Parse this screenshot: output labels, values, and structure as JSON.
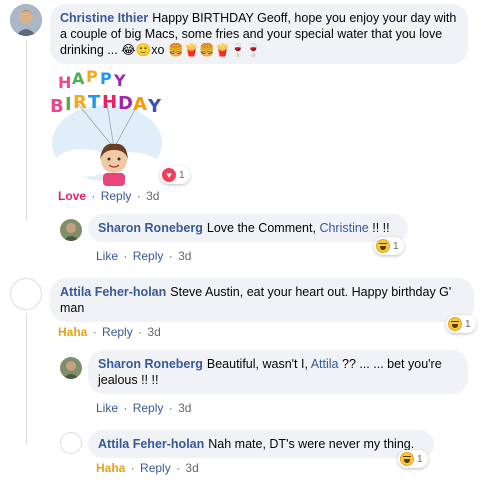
{
  "comments": [
    {
      "author": "Christine Ithier",
      "text": "Happy BIRTHDAY Geoff, hope you enjoy your day with a couple of big Macs, some fries and your special water that you love drinking ... 😂🙂xo 🍔🍟🍔🍟🍷🍷",
      "sticker_text": "HAPPY BIRTHDAY",
      "reaction_count": "1",
      "actions": {
        "reaction": "Love",
        "reply": "Reply",
        "time": "3d"
      }
    },
    {
      "author": "Sharon Roneberg",
      "text_before": "Love the Comment, ",
      "mention": "Christine",
      "text_after": " !! !!",
      "reaction_count": "1",
      "actions": {
        "like": "Like",
        "reply": "Reply",
        "time": "3d"
      }
    },
    {
      "author": "Attila Feher-holan",
      "text": "Steve Austin, eat your heart out. Happy birthday G' man",
      "reaction_count": "1",
      "actions": {
        "reaction": "Haha",
        "reply": "Reply",
        "time": "3d"
      }
    },
    {
      "author": "Sharon Roneberg",
      "text_before": "Beautiful, wasn't I, ",
      "mention": "Attila",
      "text_after": " ?? ... ... bet you're jealous !! !!",
      "actions": {
        "like": "Like",
        "reply": "Reply",
        "time": "3d"
      }
    },
    {
      "author": "Attila Feher-holan",
      "text": "Nah mate, DT's were never my thing.",
      "reaction_count": "1",
      "actions": {
        "reaction": "Haha",
        "reply": "Reply",
        "time": "3d"
      }
    }
  ],
  "separator": "·",
  "colors": {
    "link": "#385898",
    "love": "#e0245e",
    "haha": "#e3a21a",
    "bubble": "#f0f2f5"
  }
}
